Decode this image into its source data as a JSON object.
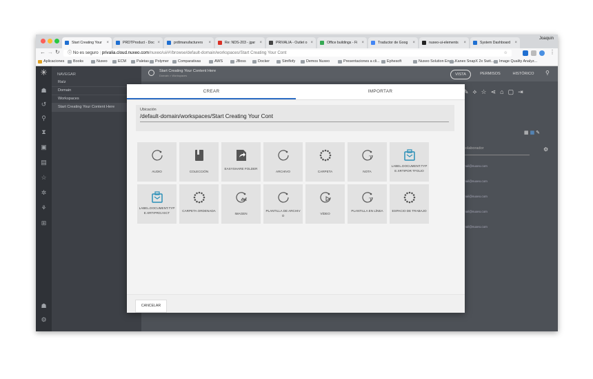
{
  "browser": {
    "profile_name": "Joaquin",
    "tabs": [
      {
        "label": "Start Creating Your",
        "icon": "nuxeo-icon",
        "color": "#1f6fd1"
      },
      {
        "label": "PRDTProduct - Doc",
        "icon": "nuxeo-icon",
        "color": "#1f6fd1"
      },
      {
        "label": "prdtmanufacturers",
        "icon": "nuxeo-icon",
        "color": "#1f6fd1"
      },
      {
        "label": "Re: NDS-203 - jgar",
        "icon": "gmail-icon",
        "color": "#d93025"
      },
      {
        "label": "PRIVALIA - Outlet o",
        "icon": "gear-icon",
        "color": "#444444"
      },
      {
        "label": "Office buildings - Fi",
        "icon": "filter-icon",
        "color": "#35a853"
      },
      {
        "label": "Traductor de Goog",
        "icon": "translate-icon",
        "color": "#4285f4"
      },
      {
        "label": "nuxeo-ui-elements",
        "icon": "github-icon",
        "color": "#222222"
      },
      {
        "label": "System Dashboard",
        "icon": "jira-icon",
        "color": "#1f6fd1"
      }
    ],
    "address": {
      "security": "No es seguro",
      "host": "privalia.cloud.nuxeo.com",
      "path": "/nuxeo/ui/#!/browse/default-domain/workspaces/Start Creating Your Cont"
    },
    "bookmarks": [
      "Aplicaciones",
      "Books",
      "Nuxeo",
      "ECM",
      "Paletas",
      "Polymer",
      "Comparativas",
      "AWS",
      "JBoss",
      "Docker",
      "Simflofy",
      "Demos Nuxeo",
      "Presentaciones a cli...",
      "Ephesoft",
      "Nuxeo Solution Engi...",
      "Kanex SnapX 2x Swit...",
      "Image Quality Analyz..."
    ]
  },
  "app": {
    "nav_title": "NAVEGAR",
    "nav_items": [
      "Raíz",
      "Domain",
      "Workspaces",
      "Start Creating Your Content Here"
    ],
    "breadcrumb": "Start Creating Your Content Here",
    "breadcrumb_sub": "Domain > Workspaces",
    "top_actions": [
      "VISTA",
      "PERMISOS",
      "HISTÓRICO"
    ],
    "bg_field_placeholder": "colaborador",
    "bg_rows": [
      "mail@nuxeo.com",
      "mail@nuxeo.com",
      "mail@nuxeo.com",
      "mail@nuxeo.com",
      "mail@nuxeo.com"
    ]
  },
  "modal": {
    "tabs": [
      "CREAR",
      "IMPORTAR"
    ],
    "location_label": "Ubicación",
    "location_value": "/default-domain/workspaces/Start Creating Your Cont",
    "doc_types": [
      {
        "label": "AUDIO",
        "icon": "audio-icon"
      },
      {
        "label": "COLECCIÓN",
        "icon": "collection-icon"
      },
      {
        "label": "EASYSHARE FOLDER",
        "icon": "share-folder-icon"
      },
      {
        "label": "ARCHIVO",
        "icon": "file-icon"
      },
      {
        "label": "CARPETA",
        "icon": "folder-icon"
      },
      {
        "label": "NOTA",
        "icon": "note-icon"
      },
      {
        "label": "LABEL.DOCUMENT.TYPE.XRTIPOR TFOLIO",
        "icon": "portfolio-icon"
      },
      {
        "label": "LABEL.DOCUMENT.TYPE.XRTIPROJ ECT",
        "icon": "project-icon"
      },
      {
        "label": "CARPETA ORDENADA",
        "icon": "ordered-folder-icon"
      },
      {
        "label": "IMAGEN",
        "icon": "image-icon"
      },
      {
        "label": "PLANTILLA DE ARCHIVO",
        "icon": "file-template-icon"
      },
      {
        "label": "VÍDEO",
        "icon": "video-icon"
      },
      {
        "label": "PLANTILLA EN LÍNEA",
        "icon": "online-template-icon"
      },
      {
        "label": "ESPACIO DE TRABAJO",
        "icon": "workspace-icon"
      }
    ],
    "cancel_label": "CANCELAR"
  },
  "colors": {
    "accent": "#2b6cc4",
    "fab": "#1a73e8",
    "sidebar": "#2f3237"
  }
}
